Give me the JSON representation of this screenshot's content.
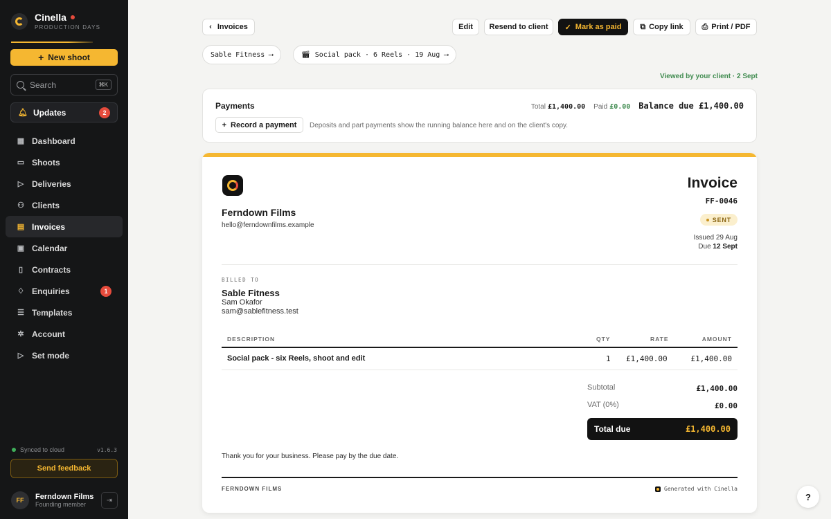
{
  "app": {
    "name": "Cinella",
    "tagline": "PRODUCTION DAYS"
  },
  "sidebar": {
    "new_shoot": "New shoot",
    "search_placeholder": "Search",
    "search_shortcut": "⌘K",
    "updates_label": "Updates",
    "updates_count": "2",
    "items": [
      {
        "label": "Dashboard",
        "icon": "grid-icon"
      },
      {
        "label": "Shoots",
        "icon": "folder-icon"
      },
      {
        "label": "Deliveries",
        "icon": "play-icon"
      },
      {
        "label": "Clients",
        "icon": "users-icon"
      },
      {
        "label": "Invoices",
        "icon": "invoice-icon"
      },
      {
        "label": "Calendar",
        "icon": "calendar-icon"
      },
      {
        "label": "Contracts",
        "icon": "document-icon"
      },
      {
        "label": "Enquiries",
        "icon": "bell-icon",
        "badge": "1"
      },
      {
        "label": "Templates",
        "icon": "list-icon"
      },
      {
        "label": "Account",
        "icon": "gear-icon"
      },
      {
        "label": "Set mode",
        "icon": "play-icon"
      }
    ],
    "sync_status": "Synced to cloud",
    "version": "v1.6.3",
    "feedback": "Send feedback",
    "user": {
      "initials": "FF",
      "name": "Ferndown Films",
      "role": "Founding member"
    }
  },
  "toolbar": {
    "back": "Invoices",
    "edit": "Edit",
    "resend": "Resend to client",
    "mark_paid": "Mark as paid",
    "copy_link": "Copy link",
    "print": "Print / PDF"
  },
  "chips": {
    "client": "Sable Fitness ⟶",
    "project": "Social pack · 6 Reels · 19 Aug ⟶"
  },
  "viewed_status": "Viewed by your client · 2 Sept",
  "payments": {
    "title": "Payments",
    "total_label": "Total",
    "total_value": "£1,400.00",
    "paid_label": "Paid",
    "paid_value": "£0.00",
    "balance": "Balance due £1,400.00",
    "record_button": "Record a payment",
    "hint": "Deposits and part payments show the running balance here and on the client's copy."
  },
  "invoice": {
    "company_name": "Ferndown Films",
    "company_email": "hello@ferndownfilms.example",
    "title": "Invoice",
    "number": "FF-0046",
    "status": "SENT",
    "issued": "Issued 29 Aug",
    "due_prefix": "Due",
    "due_date": "12 Sept",
    "billed_label": "BILLED TO",
    "billed_name": "Sable Fitness",
    "billed_contact": "Sam Okafor",
    "billed_email": "sam@sablefitness.test",
    "columns": {
      "description": "DESCRIPTION",
      "qty": "QTY",
      "rate": "RATE",
      "amount": "AMOUNT"
    },
    "line_items": [
      {
        "description": "Social pack - six Reels, shoot and edit",
        "qty": "1",
        "rate": "£1,400.00",
        "amount": "£1,400.00"
      }
    ],
    "subtotal_label": "Subtotal",
    "subtotal_value": "£1,400.00",
    "vat_label": "VAT (0%)",
    "vat_value": "£0.00",
    "total_label": "Total due",
    "total_value": "£1,400.00",
    "thanks": "Thank you for your business. Please pay by the due date.",
    "footer_company": "FERNDOWN FILMS",
    "footer_generated": "Generated with Cinella"
  },
  "help_label": "?"
}
